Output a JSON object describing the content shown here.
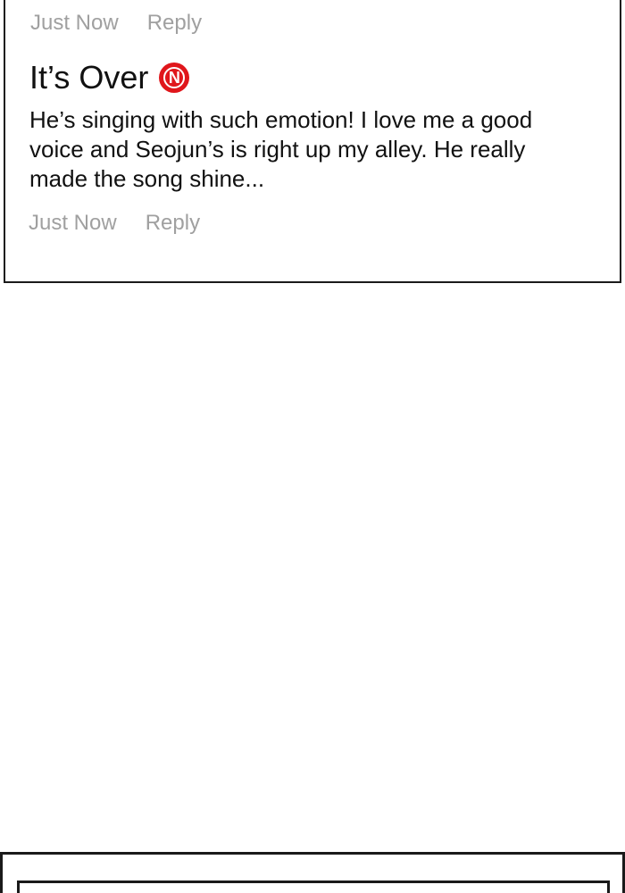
{
  "comments": [
    {
      "timestamp": "Just Now",
      "reply_label": "Reply"
    },
    {
      "author": "It’s Over",
      "badge": "N",
      "badge_color": "#e0161b",
      "text": "He’s singing with such emotion! I love me a good voice and Seojun’s is right up my alley. He really made the song shine...",
      "timestamp": "Just Now",
      "reply_label": "Reply"
    }
  ],
  "colors": {
    "meta_text": "#a0a0a0",
    "body_text": "#111111",
    "border": "#1a1a1a",
    "background": "#ffffff"
  },
  "icons": {
    "badge_icon": "new-badge-icon"
  }
}
